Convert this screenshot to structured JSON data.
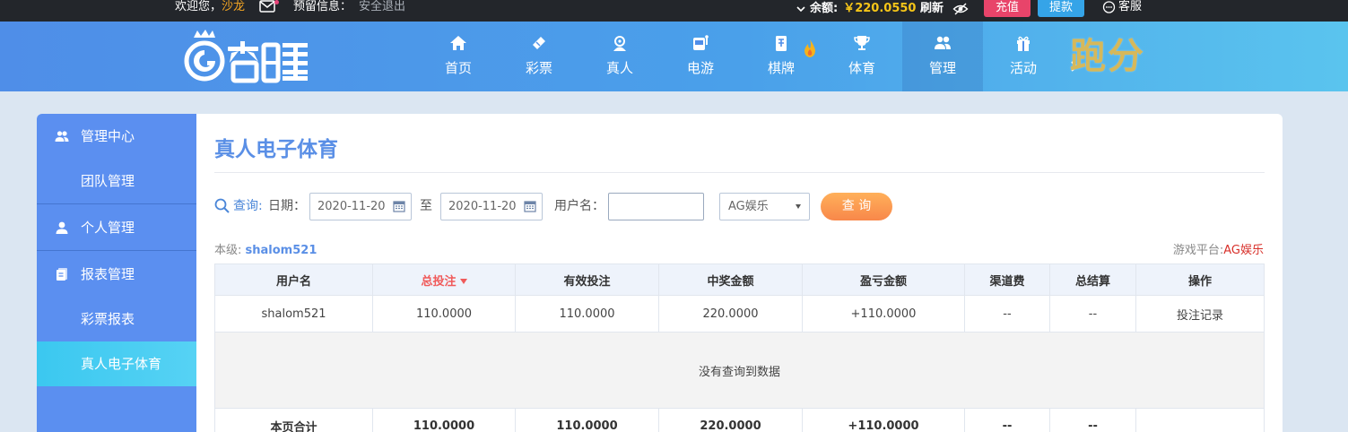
{
  "topbar": {
    "welcome_prefix": "欢迎您，",
    "username": "沙龙",
    "notice_label": "预留信息：",
    "logout": "安全退出",
    "balance_label": "余额:",
    "balance_value": "￥220.0550",
    "refresh": "刷新",
    "deposit": "充值",
    "withdraw": "提款",
    "customer_service": "客服"
  },
  "nav": {
    "items": [
      {
        "label": "首页",
        "icon": "home-icon"
      },
      {
        "label": "彩票",
        "icon": "ticket-icon"
      },
      {
        "label": "真人",
        "icon": "dealer-icon"
      },
      {
        "label": "电游",
        "icon": "slot-machine-icon"
      },
      {
        "label": "棋牌",
        "icon": "mahjong-tile-icon"
      },
      {
        "label": "体育",
        "icon": "trophy-icon"
      },
      {
        "label": "管理",
        "icon": "users-icon"
      },
      {
        "label": "活动",
        "icon": "gift-icon"
      }
    ],
    "active": "管理",
    "promo_text": "跑分"
  },
  "sidebar": {
    "items": [
      {
        "label": "管理中心",
        "icon": "users-icon",
        "type": "group"
      },
      {
        "label": "团队管理",
        "type": "sub"
      },
      {
        "label": "个人管理",
        "icon": "user-icon",
        "type": "group"
      },
      {
        "label": "报表管理",
        "icon": "report-icon",
        "type": "group"
      },
      {
        "label": "彩票报表",
        "type": "sub"
      },
      {
        "label": "真人电子体育",
        "type": "sub",
        "active": true
      }
    ]
  },
  "main": {
    "title": "真人电子体育",
    "filter": {
      "query_label": "查询:",
      "date_label": "日期：",
      "date_from": "2020-11-20",
      "to_label": "至",
      "date_to": "2020-11-20",
      "username_label": "用户名：",
      "username_value": "",
      "platform_selected": "AG娱乐",
      "search_button": "查 询"
    },
    "level_label": "本级:",
    "level_user": "shalom521",
    "platform_label": "游戏平台:",
    "platform_value": "AG娱乐",
    "table": {
      "headers": [
        "用户名",
        "总投注",
        "有效投注",
        "中奖金额",
        "盈亏金额",
        "渠道费",
        "总结算",
        "操作"
      ],
      "sorted_column": "总投注",
      "rows": [
        [
          "shalom521",
          "110.0000",
          "110.0000",
          "220.0000",
          "+110.0000",
          "--",
          "--",
          "投注记录"
        ]
      ],
      "empty_message": "没有查询到数据",
      "summary": [
        "本页合计",
        "110.0000",
        "110.0000",
        "220.0000",
        "+110.0000",
        "--",
        "--",
        ""
      ]
    }
  },
  "colors": {
    "nav_blue": "#4f8ee8",
    "sidebar_blue": "#5b8ff0",
    "active_cyan": "#3bc8f0",
    "title_blue": "#5a8fe6",
    "balance_yellow": "#f5c518",
    "deposit_pink": "#e8446a",
    "withdraw_blue": "#35a4e8",
    "profit_green": "#3a9a3a",
    "query_orange": "#f8874a"
  }
}
